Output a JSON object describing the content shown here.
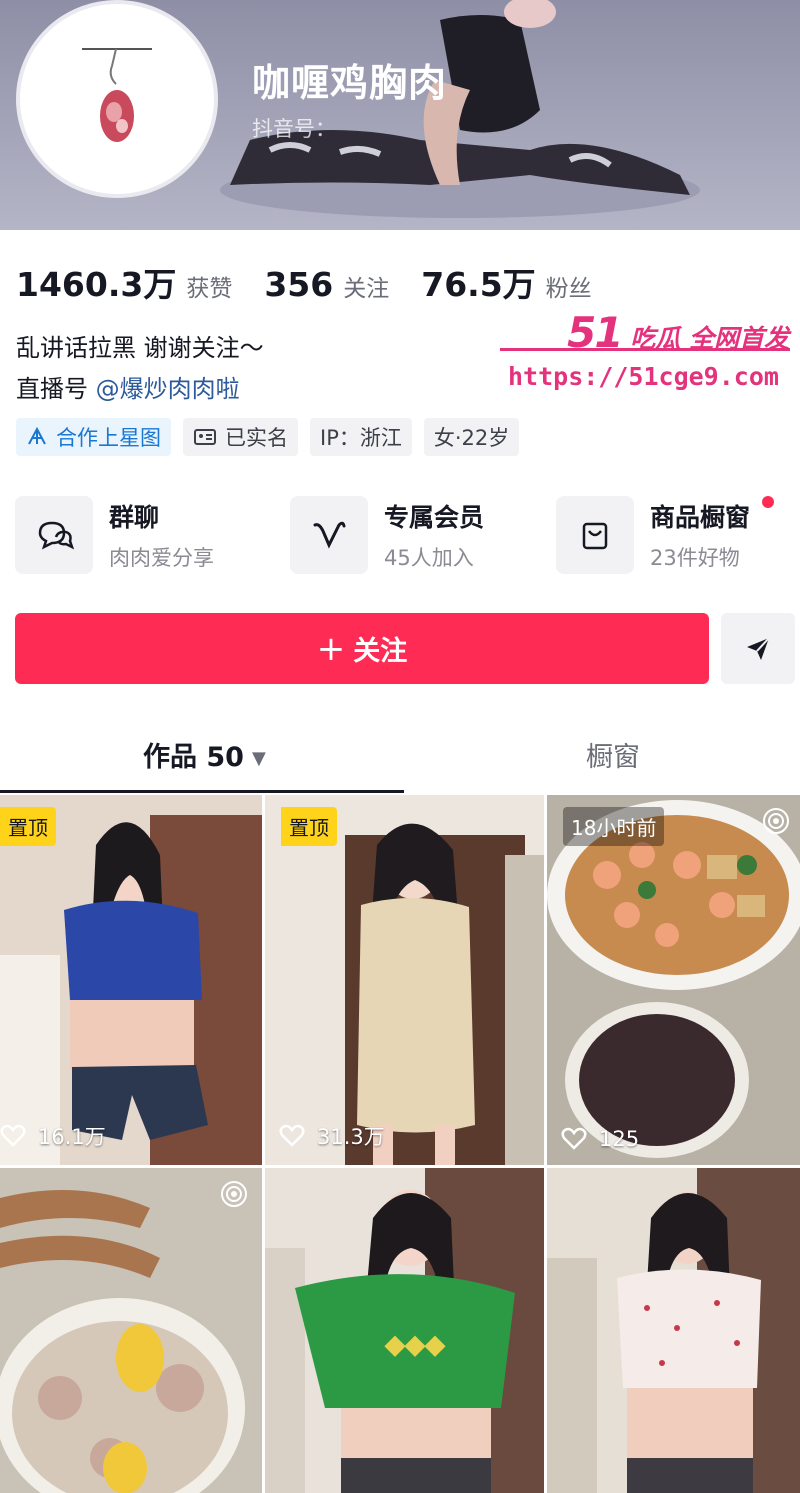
{
  "profile": {
    "nickname": "咖喱鸡胸肉",
    "douyin_id_label": "抖音号：",
    "stats": [
      {
        "value": "1460.3万",
        "label": "获赞"
      },
      {
        "value": "356",
        "label": "关注"
      },
      {
        "value": "76.5万",
        "label": "粉丝"
      }
    ],
    "bio_line1": "乱讲话拉黑 谢谢关注～",
    "bio_line2_prefix": "直播号",
    "bio_line2_mention": "@爆炒肉肉啦",
    "tags": [
      {
        "label": "合作上星图",
        "icon": "star-map-icon"
      },
      {
        "label": "已实名",
        "icon": "id-card-icon"
      },
      {
        "label": "IP：浙江"
      },
      {
        "label": "女·22岁"
      }
    ]
  },
  "watermark": {
    "top_num": "51",
    "top_text": "吃瓜 全网首发",
    "url": "https://51cge9.com"
  },
  "features": [
    {
      "title": "群聊",
      "subtitle": "肉肉爱分享",
      "icon": "chat-bubbles-icon"
    },
    {
      "title": "专属会员",
      "subtitle": "45人加入",
      "icon": "v-membership-icon"
    },
    {
      "title": "商品橱窗",
      "subtitle": "23件好物",
      "icon": "shopping-bag-icon",
      "badge": true
    }
  ],
  "actions": {
    "follow_label": "关注",
    "follow_plus": "+"
  },
  "tabs": {
    "works_label": "作品 50",
    "works_caret": "▼",
    "window_label": "橱窗"
  },
  "videos": [
    {
      "badge": "置顶",
      "likes": "16.1万"
    },
    {
      "badge": "置顶",
      "likes": "31.3万"
    },
    {
      "time": "18小时前",
      "likes": "125",
      "live": true
    },
    {
      "live": true
    },
    {},
    {}
  ],
  "colors": {
    "accent": "#fe2c55",
    "pin": "#ffd31a",
    "watermark": "#e5327d",
    "link": "#2d5a9a"
  }
}
